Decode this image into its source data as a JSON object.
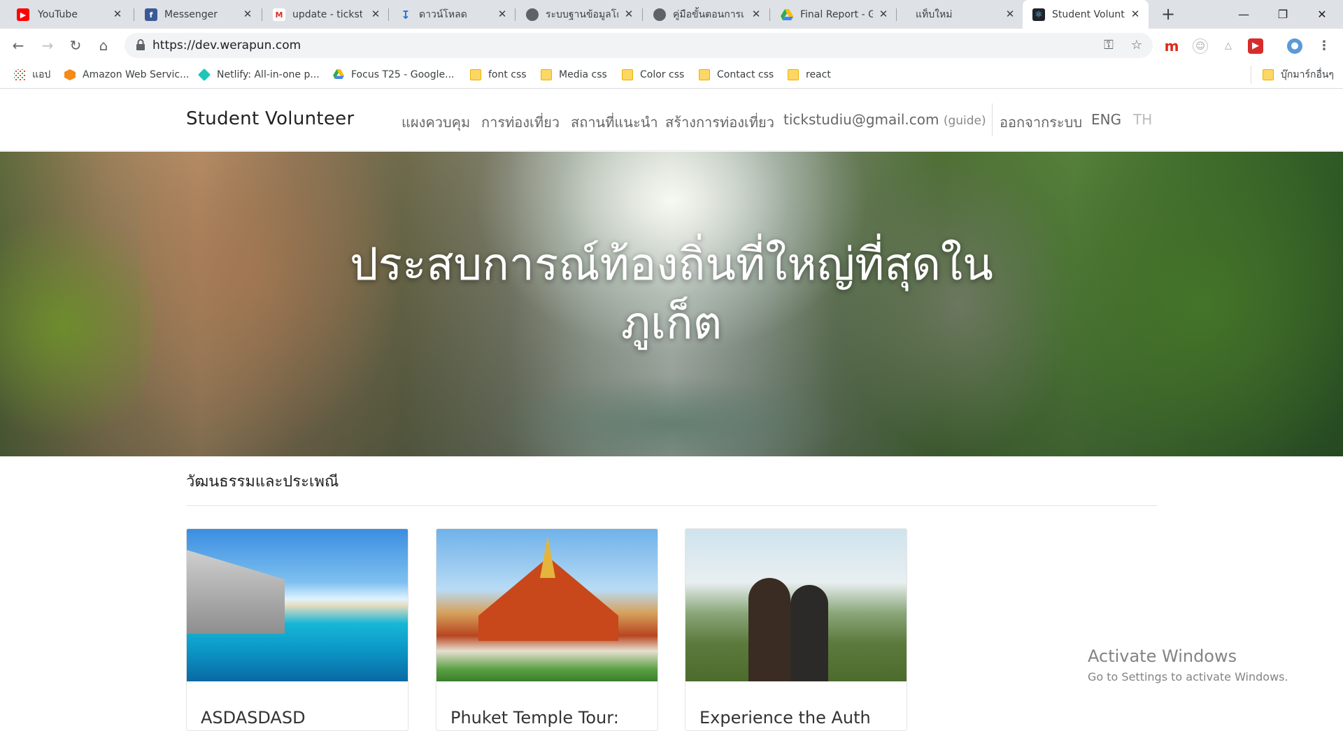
{
  "browser": {
    "tabs": [
      {
        "label": "YouTube",
        "icon": "youtube-icon"
      },
      {
        "label": "Messenger",
        "icon": "facebook-icon"
      },
      {
        "label": "update - tickstu",
        "icon": "gmail-icon"
      },
      {
        "label": "ดาวน์โหลด",
        "icon": "download-icon"
      },
      {
        "label": "ระบบฐานข้อมูลโค",
        "icon": "globe-icon"
      },
      {
        "label": "คู่มือขั้นตอนการเ",
        "icon": "globe-icon"
      },
      {
        "label": "Final Report - G",
        "icon": "google-drive-icon"
      },
      {
        "label": "แท็บใหม่",
        "icon": ""
      },
      {
        "label": "Student Volunt",
        "icon": "react-icon",
        "active": true
      }
    ],
    "url": "https://dev.werapun.com",
    "bookmarks": [
      {
        "label": "แอป",
        "icon": "apps-grid-icon"
      },
      {
        "label": "Amazon Web Servic...",
        "icon": "aws-icon"
      },
      {
        "label": "Netlify: All-in-one p...",
        "icon": "netlify-icon"
      },
      {
        "label": "Focus T25 - Google...",
        "icon": "google-drive-icon"
      },
      {
        "label": "font css",
        "icon": "folder-icon"
      },
      {
        "label": "Media css",
        "icon": "folder-icon"
      },
      {
        "label": "Color css",
        "icon": "folder-icon"
      },
      {
        "label": "Contact css",
        "icon": "folder-icon"
      },
      {
        "label": "react",
        "icon": "folder-icon"
      }
    ],
    "other_bookmarks": "บุ๊กมาร์กอื่นๆ"
  },
  "site": {
    "brand": "Student Volunteer",
    "nav": {
      "dashboard": "แผงควบคุม",
      "tours": "การท่องเที่ยว",
      "places": "สถานที่แนะนำ",
      "create_tour": "สร้างการท่องเที่ยว",
      "email": "tickstudiu@gmail.com",
      "role": "(guide)",
      "logout": "ออกจากระบบ",
      "lang_en": "ENG",
      "lang_th": "TH"
    },
    "hero_title_line1": "ประสบการณ์ท้องถิ่นที่ใหญ่ที่สุดใน",
    "hero_title_line2": "ภูเก็ต",
    "section_title": "วัฒนธรรมและประเพณี",
    "cards": [
      {
        "title": "ASDASDASD"
      },
      {
        "title": "Phuket Temple Tour:"
      },
      {
        "title": "Experience the Auth"
      }
    ]
  },
  "watermark": {
    "line1": "Activate Windows",
    "line2": "Go to Settings to activate Windows."
  },
  "colors": {
    "tabstrip": "#dee1e6",
    "nav_text": "#666666",
    "brand_text": "#222222",
    "lang_th_muted": "#bbbbbb"
  }
}
